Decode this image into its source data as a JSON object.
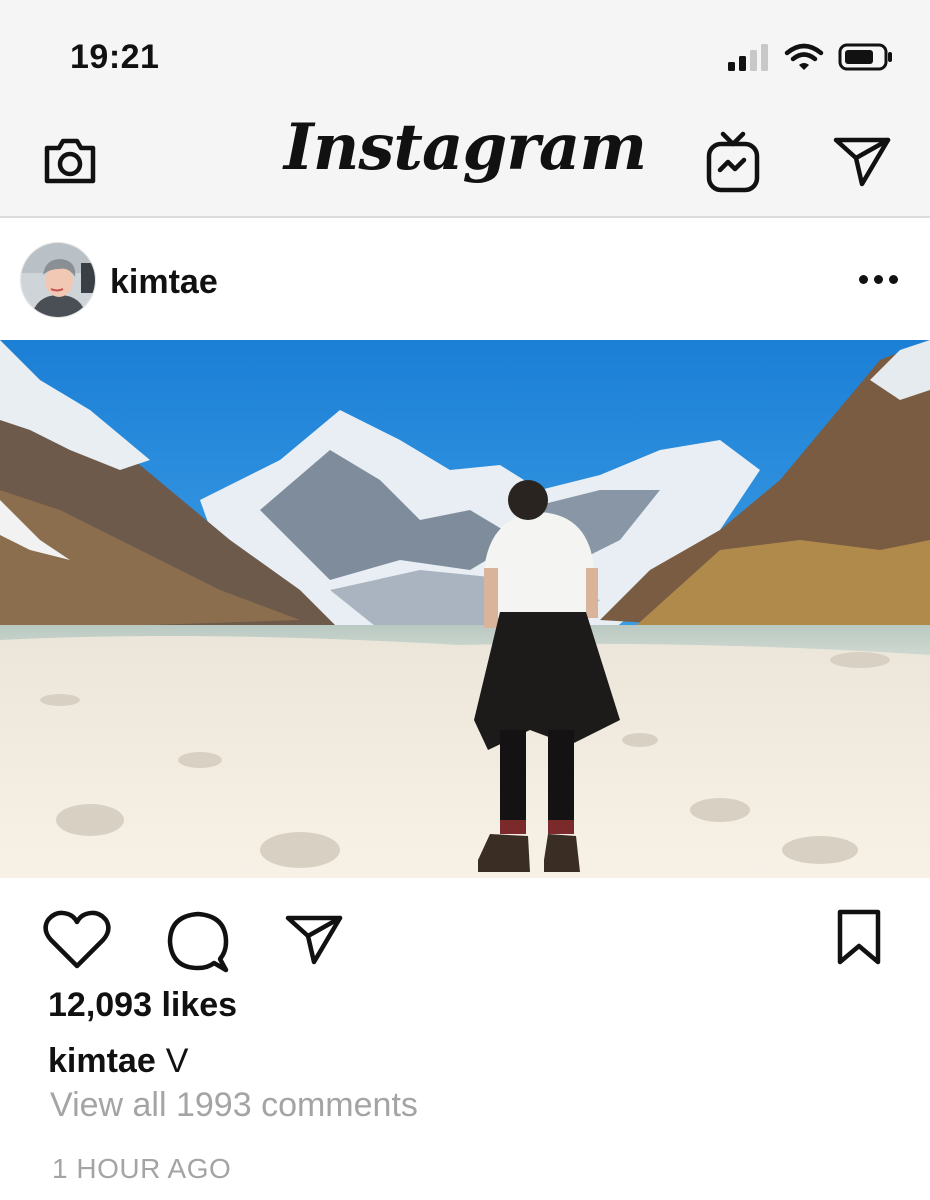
{
  "status_bar": {
    "time": "19:21",
    "icons": [
      "signal-icon",
      "wifi-icon",
      "battery-icon"
    ]
  },
  "nav": {
    "brand": "Instagram",
    "left_icon": "camera-icon",
    "right_icons": [
      "igtv-icon",
      "direct-message-icon"
    ]
  },
  "post": {
    "username": "kimtae",
    "more_icon": "more-options-icon",
    "photo_icon": "photo",
    "action_icons": [
      "heart-icon",
      "comment-icon",
      "share-icon",
      "bookmark-icon"
    ],
    "likes": "12,093 likes",
    "caption": {
      "username": "kimtae",
      "text": "V"
    },
    "view_comments": "View all 1993 comments",
    "timestamp": "1 HOUR AGO"
  },
  "colors": {
    "header_bg": "#f5f5f5",
    "text": "#111111",
    "muted": "#a4a4a4",
    "sky": "#1f8ce0"
  }
}
